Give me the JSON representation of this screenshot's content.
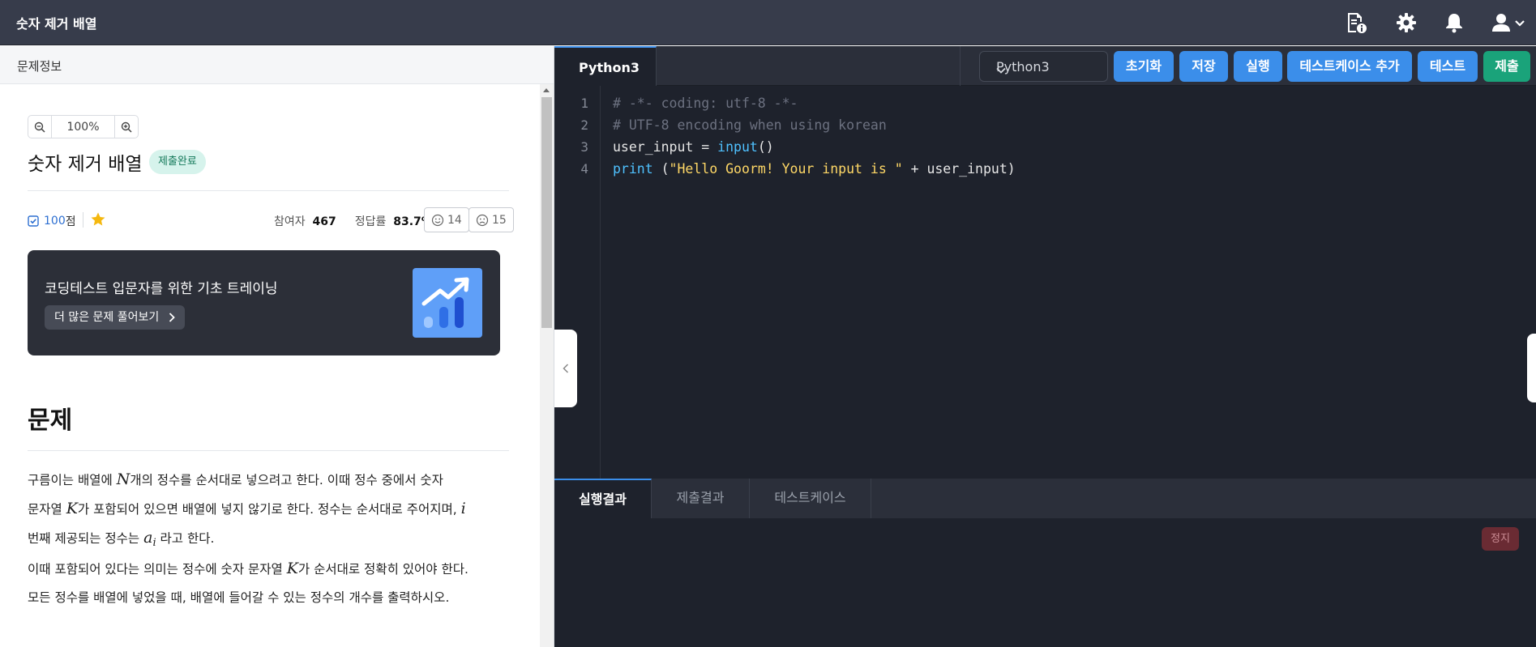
{
  "header": {
    "title": "숫자 제거 배열"
  },
  "problem_panel": {
    "tab_label": "문제정보",
    "zoom_value": "100%",
    "title": "숫자 제거 배열",
    "status_badge": "제출완료",
    "score_value": "100",
    "score_unit": "점",
    "participants_label": "참여자",
    "participants_value": "467",
    "accuracy_label": "정답률",
    "accuracy_value": "83.7%",
    "likes": "14",
    "dislikes": "15",
    "banner": {
      "text": "코딩테스트 입문자를 위한 기초 트레이닝",
      "button_label": "더 많은 문제 풀어보기"
    },
    "section_title": "문제",
    "paragraph1": {
      "t1": "구름이는 배열에 ",
      "m1": "N",
      "t2": "개의 정수를 순서대로 넣으려고 한다. 이때 정수 중에서 숫자",
      "t3": "문자열 ",
      "m2": "K",
      "t4": "가 포함되어 있으면 배열에 넣지 않기로 한다. 정수는 순서대로 주어지며, ",
      "m3": "i",
      "t5": "번째 제공되는 정수는 ",
      "m4": "a",
      "m4sub": "i",
      "t6": " 라고 한다."
    },
    "paragraph2": {
      "t1": "이때 포함되어 있다는 의미는 정수에 숫자 문자열 ",
      "m1": "K",
      "t2": "가 순서대로 정확히 있어야 한다.",
      "t3": "모든 정수를 배열에 넣었을 때, 배열에 들어갈 수 있는 정수의 개수를 출력하시오."
    }
  },
  "editor": {
    "active_tab": "Python3",
    "language_select": "Python3",
    "buttons": {
      "reset": "초기화",
      "save": "저장",
      "run": "실행",
      "add_testcase": "테스트케이스 추가",
      "test": "테스트",
      "submit": "제출"
    },
    "line_numbers": [
      "1",
      "2",
      "3",
      "4"
    ],
    "code": {
      "line1": "# -*- coding: utf-8 -*-",
      "line2": "# UTF-8 encoding when using korean",
      "line3_a": "user_input = ",
      "line3_fn": "input",
      "line3_b": "()",
      "line4_fn": "print",
      "line4_a": " (",
      "line4_str": "\"Hello Goorm! Your input is \"",
      "line4_b": " + user_input)"
    }
  },
  "output": {
    "tabs": [
      "실행결과",
      "제출결과",
      "테스트케이스"
    ],
    "stop_button": "정지"
  },
  "colors": {
    "topbar": "#373c4b",
    "accent_blue": "#3b8eea",
    "submit_green": "#1aa37a",
    "editor_bg": "#1e222c"
  }
}
